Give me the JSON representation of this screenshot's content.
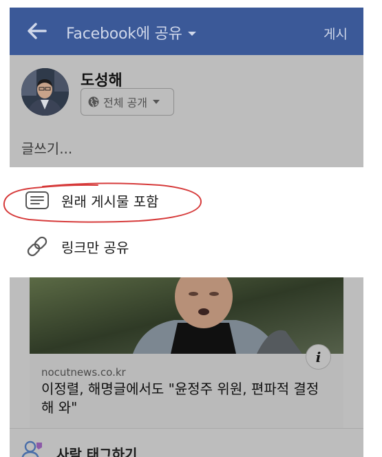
{
  "header": {
    "title": "Facebook에 공유",
    "post_label": "게시"
  },
  "composer": {
    "user_name": "도성해",
    "privacy_label": "전체 공개",
    "placeholder": "글쓰기..."
  },
  "share_menu": {
    "items": [
      {
        "label": "원래 게시물 포함",
        "icon": "lines-icon",
        "annotated": true
      },
      {
        "label": "링크만 공유",
        "icon": "link-icon",
        "annotated": false
      }
    ]
  },
  "link_card": {
    "domain": "nocutnews.co.kr",
    "headline": "이정렬, 해명글에서도 \"윤정주 위원, 편파적 결정해 와\"",
    "info_label": "i"
  },
  "tag_people": {
    "label": "사람 태그하기"
  },
  "colors": {
    "header": "#3b5998",
    "overlay": "#bdbdbd",
    "annotation": "#d63a3a"
  }
}
